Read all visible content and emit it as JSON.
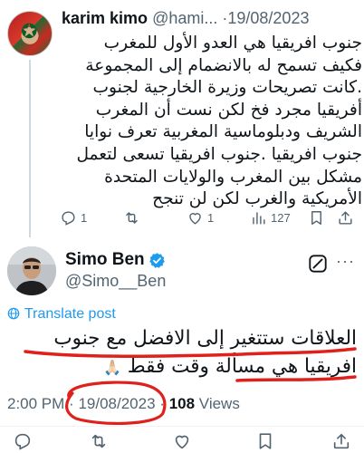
{
  "reply_tweet": {
    "display_name": "karim kimo",
    "handle": "@hami...",
    "separator": "·",
    "date": "19/08/2023",
    "text": "جنوب افريقيا هي العدو الأول للمغرب فكيف تسمح له بالانضمام إلى المجموعة .كانت تصريحات وزيرة الخارجية لجنوب أفريقيا مجرد فخ لكن نست أن المغرب الشريف ودبلوماسية المغربية تعرف نوايا جنوب افريقيا .جنوب افريقيا تسعى لتعمل مشكل بين المغرب والولايات المتحدة الأمريكية والغرب لكن لن تنجح",
    "actions": {
      "reply_count": "1",
      "retweet_count": "",
      "like_count": "1",
      "views_count": "127"
    }
  },
  "main_tweet": {
    "display_name": "Simo Ben",
    "handle": "@Simo__Ben",
    "translate_label": "Translate post",
    "text": "العلاقات ستتغير إلى الافضل مع جنوب افريقيا هي مسألة وقت فقط",
    "emoji": "🙏🏻",
    "time": "2:00 PM",
    "separator": "·",
    "date": "19/08/2023",
    "separator2": "·",
    "views_count": "108",
    "views_label": "Views"
  },
  "colors": {
    "link_blue": "#1d9bf0",
    "muted_gray": "#536471",
    "annotation_red": "#e0201b",
    "verified_blue": "#1d9bf0"
  },
  "icons": {
    "reply": "reply-icon",
    "retweet": "retweet-icon",
    "like": "heart-icon",
    "views": "views-icon",
    "bookmark": "bookmark-icon",
    "share": "share-icon",
    "verified": "verified-badge-icon",
    "grok": "grok-icon",
    "more": "more-icon",
    "translate": "globe-icon"
  }
}
